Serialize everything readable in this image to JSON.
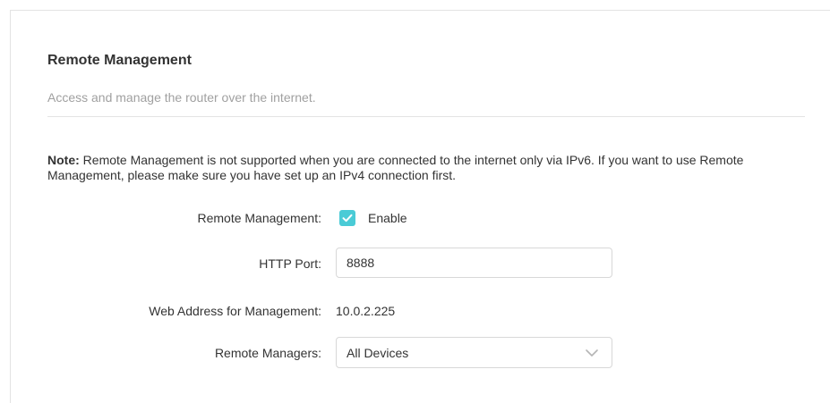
{
  "section": {
    "title": "Remote Management",
    "description": "Access and manage the router over the internet."
  },
  "note": {
    "prefix": "Note:",
    "text": " Remote Management is not supported when you are connected to the internet only via IPv6. If you want to use Remote Management, please make sure you have set up an IPv4 connection first."
  },
  "fields": {
    "remote_management": {
      "label": "Remote Management:",
      "checkbox_label": "Enable",
      "checked": true
    },
    "http_port": {
      "label": "HTTP Port:",
      "value": "8888"
    },
    "web_address": {
      "label": "Web Address for Management:",
      "value": "10.0.2.225"
    },
    "remote_managers": {
      "label": "Remote Managers:",
      "selected": "All Devices"
    }
  },
  "colors": {
    "accent": "#4acbd6",
    "text": "#333333",
    "muted": "#a0a0a0",
    "border": "#d8d8d8"
  },
  "icons": {
    "checkbox": "check-icon",
    "dropdown": "chevron-down-icon"
  }
}
